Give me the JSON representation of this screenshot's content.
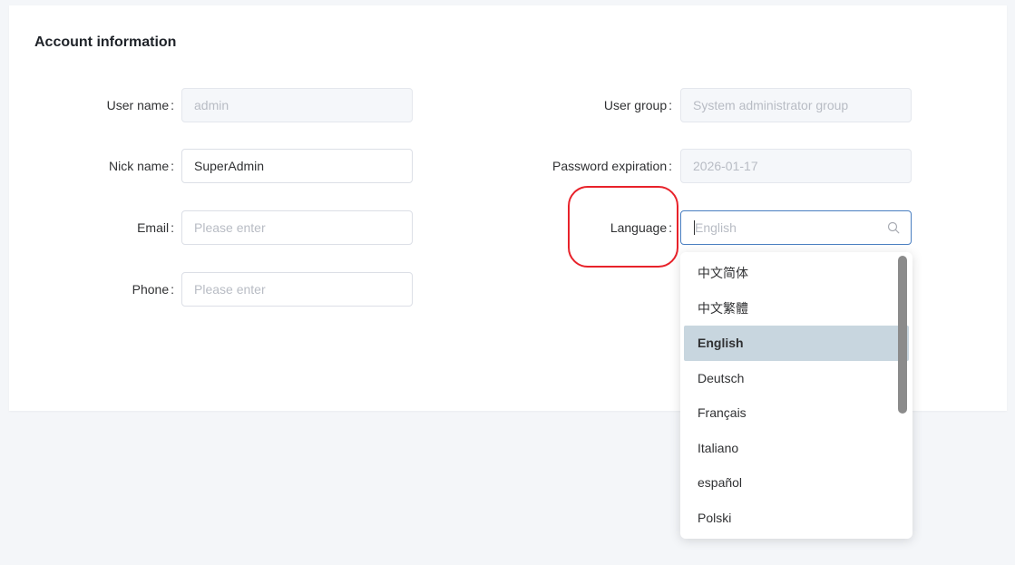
{
  "section": {
    "title": "Account information"
  },
  "fields": {
    "username": {
      "label": "User name",
      "value": "admin"
    },
    "nickname": {
      "label": "Nick name",
      "value": "SuperAdmin"
    },
    "email": {
      "label": "Email",
      "placeholder": "Please enter"
    },
    "phone": {
      "label": "Phone",
      "placeholder": "Please enter"
    },
    "usergroup": {
      "label": "User group",
      "value": "System administrator group"
    },
    "password_expiration": {
      "label": "Password expiration",
      "value": "2026-01-17"
    },
    "language": {
      "label": "Language",
      "placeholder": "English",
      "icon": "search-icon"
    }
  },
  "colon": ":",
  "dropdown": {
    "options": [
      "中文简体",
      "中文繁體",
      "English",
      "Deutsch",
      "Français",
      "Italiano",
      "español",
      "Polski"
    ],
    "selected": "English"
  },
  "colors": {
    "annotation": "#e8222a",
    "focus_border": "#4a7fc1",
    "selected_bg": "#c8d6df"
  }
}
